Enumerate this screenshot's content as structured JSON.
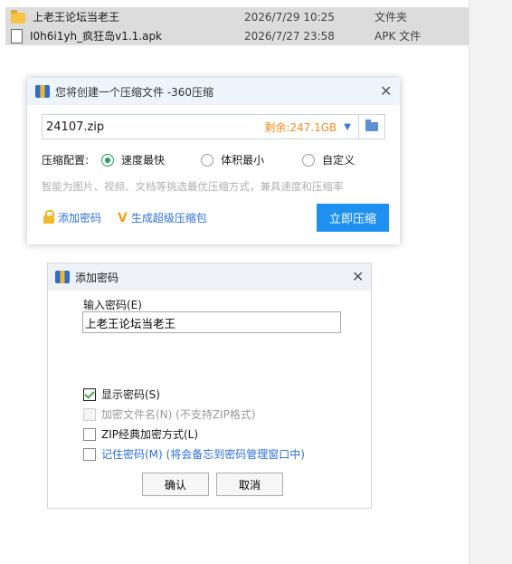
{
  "files": [
    {
      "name": "上老王论坛当老王",
      "date": "2026/7/29 10:25",
      "type": "文件夹",
      "icon": "folder-icon"
    },
    {
      "name": "I0h6i1yh_疯狂岛v1.1.apk",
      "date": "2026/7/27 23:58",
      "type": "APK 文件",
      "icon": "file-icon"
    }
  ],
  "zip_dialog": {
    "title": "您将创建一个压缩文件 -360压缩",
    "filename": "24107.zip",
    "free_space": "剩余:247.1GB",
    "config_label": "压缩配置:",
    "options": [
      "速度最快",
      "体积最小",
      "自定义"
    ],
    "selected_option": "速度最快",
    "hint": "智能为图片、视频、文档等挑选最优压缩方式，兼具速度和压缩率",
    "add_password": "添加密码",
    "super_zip": "生成超级压缩包",
    "compress_button": "立即压缩"
  },
  "password_dialog": {
    "title": "添加密码",
    "input_label": "输入密码(E)",
    "password_value": "上老王论坛当老王",
    "options": [
      {
        "label": "显示密码(S)",
        "checked": true,
        "enabled": true
      },
      {
        "label": "加密文件名(N) (不支持ZIP格式)",
        "checked": false,
        "enabled": false
      },
      {
        "label": "ZIP经典加密方式(L)",
        "checked": false,
        "enabled": true
      },
      {
        "label": "记住密码(M) (将会备忘到密码管理窗口中)",
        "checked": false,
        "enabled": true
      }
    ],
    "ok_button": "确认",
    "cancel_button": "取消"
  },
  "colors": {
    "accent": "#1e90f0",
    "selected_radio": "#19a05a",
    "free_space": "#f08c1e",
    "link": "#2c6fd6"
  }
}
